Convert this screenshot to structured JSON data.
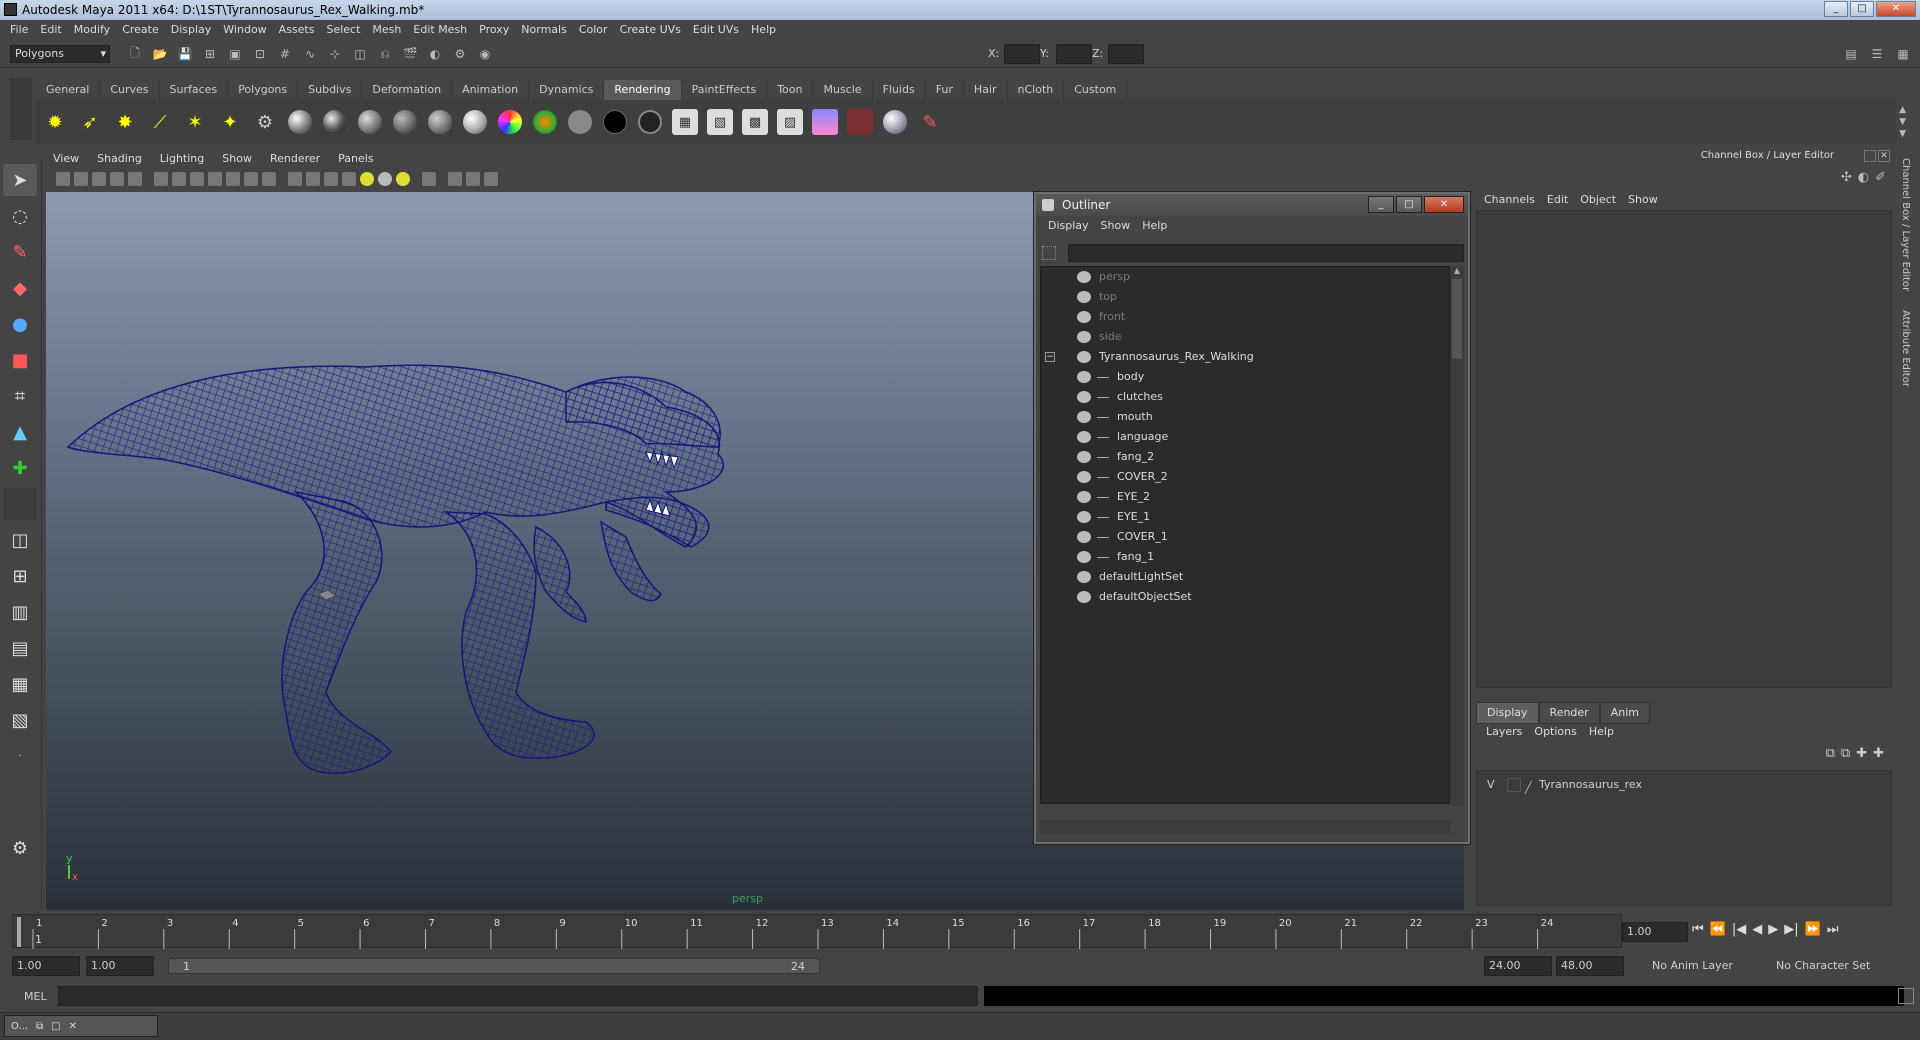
{
  "title": "Autodesk Maya 2011 x64: D:\\1ST\\Tyrannosaurus_Rex_Walking.mb*",
  "menubar": [
    "File",
    "Edit",
    "Modify",
    "Create",
    "Display",
    "Window",
    "Assets",
    "Select",
    "Mesh",
    "Edit Mesh",
    "Proxy",
    "Normals",
    "Color",
    "Create UVs",
    "Edit UVs",
    "Help"
  ],
  "statusline": {
    "mode": "Polygons",
    "x_label": "X:",
    "y_label": "Y:",
    "z_label": "Z:"
  },
  "shelf_tabs": [
    "General",
    "Curves",
    "Surfaces",
    "Polygons",
    "Subdivs",
    "Deformation",
    "Animation",
    "Dynamics",
    "Rendering",
    "PaintEffects",
    "Toon",
    "Muscle",
    "Fluids",
    "Fur",
    "Hair",
    "nCloth",
    "Custom"
  ],
  "active_shelf": "Rendering",
  "panel_menu": [
    "View",
    "Shading",
    "Lighting",
    "Show",
    "Renderer",
    "Panels"
  ],
  "viewport": {
    "camera": "persp",
    "axis_y": "y",
    "axis_x": "x"
  },
  "outliner": {
    "title": "Outliner",
    "menu": [
      "Display",
      "Show",
      "Help"
    ],
    "items": [
      {
        "label": "persp",
        "depth": 0,
        "dim": true,
        "expand": ""
      },
      {
        "label": "top",
        "depth": 0,
        "dim": true,
        "expand": ""
      },
      {
        "label": "front",
        "depth": 0,
        "dim": true,
        "expand": ""
      },
      {
        "label": "side",
        "depth": 0,
        "dim": true,
        "expand": ""
      },
      {
        "label": "Tyrannosaurus_Rex_Walking",
        "depth": 0,
        "dim": false,
        "expand": "−"
      },
      {
        "label": "body",
        "depth": 1,
        "dim": false,
        "expand": ""
      },
      {
        "label": "clutches",
        "depth": 1,
        "dim": false,
        "expand": ""
      },
      {
        "label": "mouth",
        "depth": 1,
        "dim": false,
        "expand": ""
      },
      {
        "label": "language",
        "depth": 1,
        "dim": false,
        "expand": ""
      },
      {
        "label": "fang_2",
        "depth": 1,
        "dim": false,
        "expand": ""
      },
      {
        "label": "COVER_2",
        "depth": 1,
        "dim": false,
        "expand": ""
      },
      {
        "label": "EYE_2",
        "depth": 1,
        "dim": false,
        "expand": ""
      },
      {
        "label": "EYE_1",
        "depth": 1,
        "dim": false,
        "expand": ""
      },
      {
        "label": "COVER_1",
        "depth": 1,
        "dim": false,
        "expand": ""
      },
      {
        "label": "fang_1",
        "depth": 1,
        "dim": false,
        "expand": ""
      },
      {
        "label": "defaultLightSet",
        "depth": 0,
        "dim": false,
        "expand": ""
      },
      {
        "label": "defaultObjectSet",
        "depth": 0,
        "dim": false,
        "expand": ""
      }
    ]
  },
  "channelbox": {
    "title": "Channel Box / Layer Editor",
    "menu": [
      "Channels",
      "Edit",
      "Object",
      "Show"
    ],
    "layer_tabs": [
      "Display",
      "Render",
      "Anim"
    ],
    "layer_menu": [
      "Layers",
      "Options",
      "Help"
    ],
    "layer": {
      "visible": "V",
      "name": "Tyrannosaurus_rex"
    }
  },
  "side_tabs": [
    "Channel Box / Layer Editor",
    "Attribute Editor"
  ],
  "timeline": {
    "ticks": [
      "1",
      "2",
      "3",
      "4",
      "5",
      "6",
      "7",
      "8",
      "9",
      "10",
      "11",
      "12",
      "13",
      "14",
      "15",
      "16",
      "17",
      "18",
      "19",
      "20",
      "21",
      "22",
      "23",
      "24"
    ],
    "current_frame": "1.00",
    "start_marker": "1"
  },
  "range": {
    "start_time": "1.00",
    "playback_start": "1.00",
    "range_start": "1",
    "range_end": "24",
    "playback_end": "24.00",
    "end_time": "48.00",
    "anim_layer": "No Anim Layer",
    "character_set": "No Character Set"
  },
  "cmd": {
    "label": "MEL"
  },
  "taskbar": {
    "label": "O..."
  }
}
